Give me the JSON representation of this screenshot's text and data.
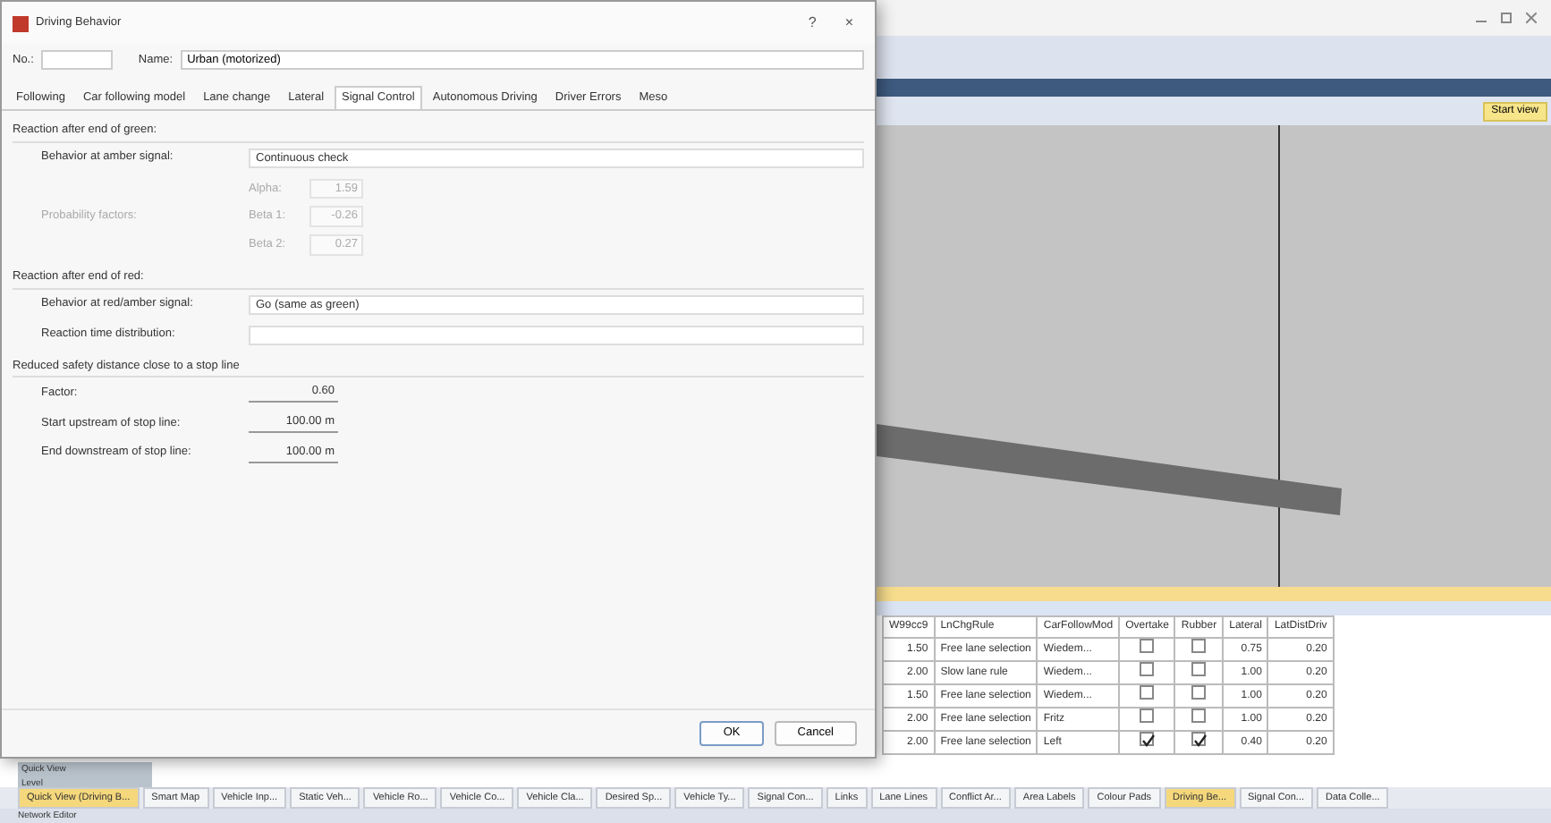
{
  "dialog": {
    "title": "Driving Behavior",
    "help": "?",
    "close": "×",
    "number_label": "No.:",
    "name_label": "Name:",
    "name_value": "Urban (motorized)",
    "tabs": [
      {
        "label": "Following",
        "selected": false
      },
      {
        "label": "Car following model",
        "selected": false
      },
      {
        "label": "Lane change",
        "selected": false
      },
      {
        "label": "Lateral",
        "selected": false
      },
      {
        "label": "Signal Control",
        "selected": true
      },
      {
        "label": "Autonomous Driving",
        "selected": false
      },
      {
        "label": "Driver Errors",
        "selected": false
      },
      {
        "label": "Meso",
        "selected": false
      }
    ],
    "sections": [
      {
        "title": "Reaction after end of green:",
        "rows": [
          {
            "kind": "select",
            "label": "Behavior at amber signal:",
            "value": "Continuous check",
            "disabled": false
          },
          {
            "kind": "factors",
            "label": "Probability factors:",
            "disabled": true,
            "factors": [
              {
                "label": "Alpha:",
                "value": "1.59"
              },
              {
                "label": "Beta 1:",
                "value": "-0.26"
              },
              {
                "label": "Beta 2:",
                "value": "0.27"
              }
            ]
          }
        ]
      },
      {
        "title": "Reaction after end of red:",
        "rows": [
          {
            "kind": "select",
            "label": "Behavior at red/amber signal:",
            "value": "Go (same as green)",
            "disabled": false
          },
          {
            "kind": "select",
            "label": "Reaction time distribution:",
            "disabled": false
          }
        ]
      },
      {
        "title": "Reduced safety distance close to a stop line",
        "rows": [
          {
            "kind": "number",
            "label": "Factor:",
            "value": "0.60",
            "disabled": false
          },
          {
            "kind": "number",
            "label": "Start upstream of stop line:",
            "value": "100.00 m",
            "disabled": false
          },
          {
            "kind": "number",
            "label": "End downstream of stop line:",
            "value": "100.00 m",
            "disabled": false
          }
        ]
      }
    ],
    "buttons": [
      {
        "label": "OK",
        "primary": true
      },
      {
        "label": "Cancel",
        "primary": false
      }
    ]
  },
  "viewport": {
    "view_button": "Start view"
  },
  "table": {
    "columns": [
      "W99cc9",
      "LnChgRule",
      "CarFollowMod",
      "Overtake",
      "Rubber",
      "Lateral",
      "LatDistDriv"
    ],
    "rows": [
      {
        "w": "1.50",
        "rule": "Free lane selection",
        "model": "Wiedem...",
        "overtake": false,
        "rubber": false,
        "lateral": "0.75",
        "latdist": "0.20"
      },
      {
        "w": "2.00",
        "rule": "Slow lane rule",
        "model": "Wiedem...",
        "overtake": false,
        "rubber": false,
        "lateral": "1.00",
        "latdist": "0.20"
      },
      {
        "w": "1.50",
        "rule": "Free lane selection",
        "model": "Wiedem...",
        "overtake": false,
        "rubber": false,
        "lateral": "1.00",
        "latdist": "0.20"
      },
      {
        "w": "2.00",
        "rule": "Free lane selection",
        "model": "Fritz",
        "overtake": false,
        "rubber": false,
        "lateral": "1.00",
        "latdist": "0.20"
      },
      {
        "w": "2.00",
        "rule": "Free lane selection",
        "model": "Left",
        "overtake": true,
        "rubber": true,
        "lateral": "0.40",
        "latdist": "0.20"
      }
    ]
  },
  "side_panel": {
    "title": "Quick View",
    "subtitle": "Level"
  },
  "bottom_tabs": [
    {
      "label": "Quick View (Driving B...",
      "selected": true
    },
    {
      "label": "Smart Map",
      "selected": false
    },
    {
      "label": "Vehicle Inp...",
      "selected": false
    },
    {
      "label": "Static Veh...",
      "selected": false
    },
    {
      "label": "Vehicle Ro...",
      "selected": false
    },
    {
      "label": "Vehicle Co...",
      "selected": false
    },
    {
      "label": "Vehicle Cla...",
      "selected": false
    },
    {
      "label": "Desired Sp...",
      "selected": false
    },
    {
      "label": "Vehicle Ty...",
      "selected": false
    },
    {
      "label": "Signal Con...",
      "selected": false
    },
    {
      "label": "Links",
      "selected": false
    },
    {
      "label": "Lane Lines",
      "selected": false
    },
    {
      "label": "Conflict Ar...",
      "selected": false
    },
    {
      "label": "Area Labels",
      "selected": false
    },
    {
      "label": "Colour Pads",
      "selected": false
    },
    {
      "label": "Driving Be...",
      "selected": true
    },
    {
      "label": "Signal Con...",
      "selected": false
    },
    {
      "label": "Data Colle...",
      "selected": false
    }
  ],
  "status_bar": "Network Editor"
}
